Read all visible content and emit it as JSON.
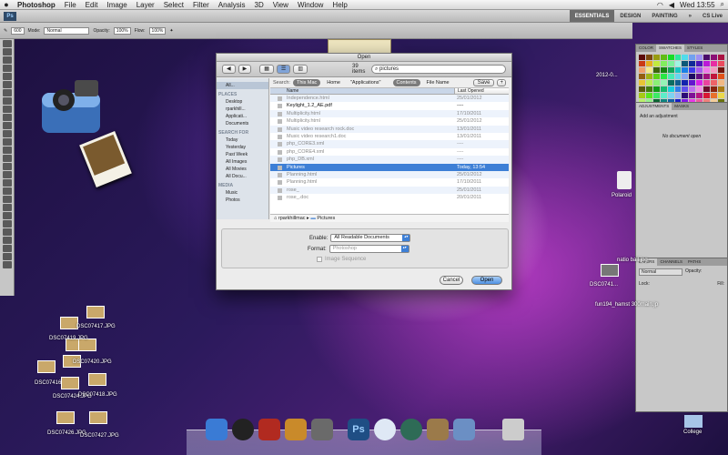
{
  "menubar": {
    "apple": "",
    "app": "Photoshop",
    "items": [
      "File",
      "Edit",
      "Image",
      "Layer",
      "Select",
      "Filter",
      "Analysis",
      "3D",
      "View",
      "Window",
      "Help"
    ],
    "clock": "Wed 13:55"
  },
  "appbar": {
    "logo": "Ps",
    "workspaces": [
      "ESSENTIALS",
      "DESIGN",
      "PAINTING"
    ],
    "cslive": "CS Live"
  },
  "options": {
    "size": "600",
    "mode_label": "Mode:",
    "mode": "Normal",
    "opacity_label": "Opacity:",
    "opacity": "100%",
    "flow_label": "Flow:",
    "flow": "100%"
  },
  "panels": {
    "color_tabs": [
      "COLOR",
      "SWATCHES",
      "STYLES"
    ],
    "adjust_tabs": [
      "ADJUSTMENTS",
      "MASKS"
    ],
    "adjust_title": "Add an adjustment",
    "adjust_msg": "No document open",
    "layers_tabs": [
      "LAYERS",
      "CHANNELS",
      "PATHS"
    ],
    "layers_mode": "Normal",
    "layers_opacity": "Opacity:",
    "layers_lock": "Lock:",
    "layers_fill": "Fill:"
  },
  "dialog": {
    "title": "Open",
    "count": "39 items",
    "search": "pictures",
    "search_label": "Search:",
    "scopes": [
      "This Mac",
      "Home",
      "\"Applications\"",
      "Contents",
      "File Name"
    ],
    "save": "Save",
    "col_name": "Name",
    "col_date": "Last Opened",
    "sidebar": [
      {
        "type": "hd",
        "text": ""
      },
      {
        "type": "it",
        "text": "All..."
      },
      {
        "type": "hd",
        "text": "PLACES"
      },
      {
        "type": "it",
        "text": "Desktop"
      },
      {
        "type": "it",
        "text": "rparkhill..."
      },
      {
        "type": "it",
        "text": "Applicati..."
      },
      {
        "type": "it",
        "text": "Documents"
      },
      {
        "type": "hd",
        "text": "SEARCH FOR"
      },
      {
        "type": "it",
        "text": "Today"
      },
      {
        "type": "it",
        "text": "Yesterday"
      },
      {
        "type": "it",
        "text": "Past Week"
      },
      {
        "type": "it",
        "text": "All Images"
      },
      {
        "type": "it",
        "text": "All Movies"
      },
      {
        "type": "it",
        "text": "All Docu..."
      },
      {
        "type": "hd",
        "text": "MEDIA"
      },
      {
        "type": "it",
        "text": "Music"
      },
      {
        "type": "it",
        "text": "Photos"
      }
    ],
    "files": [
      {
        "name": "Independence.html",
        "date": "25/01/2012",
        "en": false
      },
      {
        "name": "Keylight_1.2_AE.pdf",
        "date": "----",
        "en": true
      },
      {
        "name": "Multiplicity.html",
        "date": "17/10/2011",
        "en": false
      },
      {
        "name": "Multiplicity.html",
        "date": "25/01/2012",
        "en": false
      },
      {
        "name": "Music video research rock.doc",
        "date": "13/01/2011",
        "en": false
      },
      {
        "name": "Music video research1.doc",
        "date": "13/01/2011",
        "en": false
      },
      {
        "name": "php_CORE3.xml",
        "date": "----",
        "en": false
      },
      {
        "name": "php_CORE4.xml",
        "date": "----",
        "en": false
      },
      {
        "name": "php_DB.xml",
        "date": "----",
        "en": false
      },
      {
        "name": "Pictures",
        "date": "Today, 13:54",
        "en": true,
        "sel": true
      },
      {
        "name": "Planning.html",
        "date": "25/01/2012",
        "en": false
      },
      {
        "name": "Planning.html",
        "date": "17/10/2011",
        "en": false
      },
      {
        "name": "rose_",
        "date": "25/01/2011",
        "en": false
      },
      {
        "name": "rose_.doc",
        "date": "20/01/2011",
        "en": false
      }
    ],
    "path": [
      "rparkhillmac",
      "Pictures"
    ],
    "enable_label": "Enable:",
    "enable_value": "All Readable Documents",
    "format_label": "Format:",
    "format_value": "Photoshop",
    "sequence_label": "Image Sequence",
    "cancel": "Cancel",
    "open": "Open"
  },
  "desktop": {
    "files": [
      "DSC07417.JPG",
      "DSC07419.JPG",
      "DSC07420.JPG",
      "DSC07416.JPG",
      "DSC07418.JPG",
      "DSC07424.JPG",
      "DSC07426.JPG",
      "DSC07427.JPG"
    ],
    "right_labels": [
      "Polaroid",
      "natio ball.jpg",
      "DSC0741...",
      "fun194_hamst 300main.jp",
      "College"
    ],
    "left_labels": [
      "2012-0..."
    ]
  }
}
